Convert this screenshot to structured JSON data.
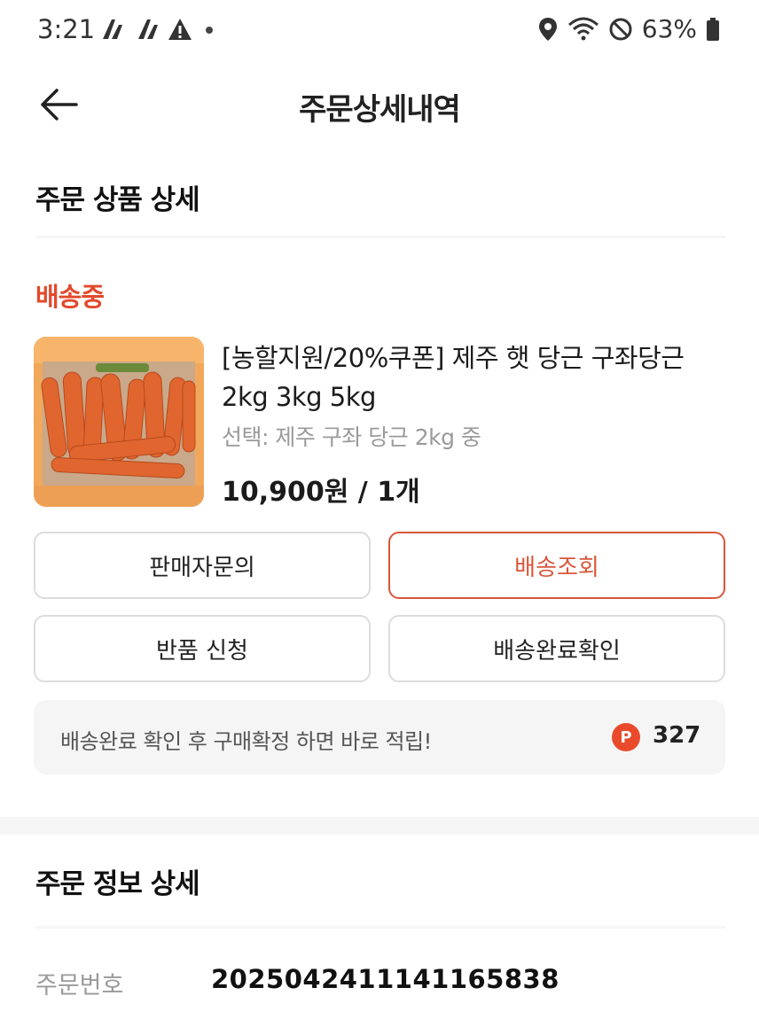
{
  "status_bar": {
    "time": "3:21",
    "battery": "63%",
    "icons": [
      "app-notification-icon",
      "app-notification-icon",
      "warning-icon",
      "dot-icon",
      "location-icon",
      "wifi-icon",
      "do-not-disturb-icon",
      "battery-icon"
    ]
  },
  "header": {
    "title": "주문상세내역"
  },
  "product_section": {
    "title": "주문 상품 상세",
    "delivery_status": "배송중",
    "product": {
      "name": "[농할지원/20%쿠폰] 제주 햇 당근 구좌당근 2kg 3kg 5kg",
      "option": "선택: 제주 구좌 당근 2kg 중",
      "price": "10,900원 / 1개"
    },
    "buttons": {
      "seller_inquiry": "판매자문의",
      "track_delivery": "배송조회",
      "return_request": "반품 신청",
      "confirm_delivery": "배송완료확인"
    },
    "notice": {
      "text": "배송완료 확인 후 구매확정 하면 바로 적립!",
      "point_icon_label": "P",
      "points": "327"
    }
  },
  "order_section": {
    "title": "주문 정보 상세",
    "order_number_label": "주문번호",
    "order_number": "2025042411141165838"
  },
  "colors": {
    "accent": "#e2492c",
    "border": "#dcdcdc",
    "notice_bg": "#f5f5f5"
  }
}
